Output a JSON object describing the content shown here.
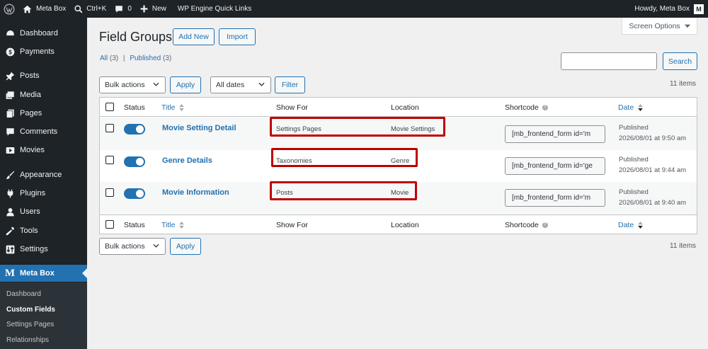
{
  "admin_bar": {
    "site_name": "Meta Box",
    "shortcut": "Ctrl+K",
    "comments_count": "0",
    "new_label": "New",
    "quick_links": "WP Engine Quick Links",
    "greeting": "Howdy, Meta Box",
    "avatar_letter": "M"
  },
  "sidebar": {
    "items": [
      {
        "label": "Dashboard",
        "icon": "dashboard-icon"
      },
      {
        "label": "Payments",
        "icon": "dollar-icon"
      },
      {
        "label": "Posts",
        "icon": "pin-icon"
      },
      {
        "label": "Media",
        "icon": "media-icon"
      },
      {
        "label": "Pages",
        "icon": "pages-icon"
      },
      {
        "label": "Comments",
        "icon": "comment-icon"
      },
      {
        "label": "Movies",
        "icon": "video-icon"
      },
      {
        "label": "Appearance",
        "icon": "paintbrush-icon"
      },
      {
        "label": "Plugins",
        "icon": "plugin-icon"
      },
      {
        "label": "Users",
        "icon": "user-icon"
      },
      {
        "label": "Tools",
        "icon": "wrench-icon"
      },
      {
        "label": "Settings",
        "icon": "settings-icon"
      }
    ],
    "current": {
      "label": "Meta Box",
      "icon_letter": "M"
    },
    "submenu": [
      "Dashboard",
      "Custom Fields",
      "Settings Pages",
      "Relationships"
    ]
  },
  "page": {
    "title": "Field Groups",
    "add_new": "Add New",
    "import": "Import",
    "screen_options": "Screen Options",
    "filters": {
      "all": "All",
      "all_count": "(3)",
      "separator": "|",
      "published": "Published",
      "published_count": "(3)"
    },
    "search_button": "Search",
    "bulk_actions": "Bulk actions",
    "apply": "Apply",
    "all_dates": "All dates",
    "filter": "Filter",
    "items_count": "11 items"
  },
  "table": {
    "columns": {
      "status": "Status",
      "title": "Title",
      "show_for": "Show For",
      "location": "Location",
      "shortcode": "Shortcode",
      "date": "Date"
    },
    "rows": [
      {
        "title": "Movie Setting Detail",
        "show_for": "Settings Pages",
        "location": "Movie Settings",
        "shortcode": "[mb_frontend_form id='m",
        "status": "Published",
        "date": "2026/08/01 at 9:50 am"
      },
      {
        "title": "Genre Details",
        "show_for": "Taxonomies",
        "location": "Genre",
        "shortcode": "[mb_frontend_form id='ge",
        "status": "Published",
        "date": "2026/08/01 at 9:44 am"
      },
      {
        "title": "Movie Information",
        "show_for": "Posts",
        "location": "Movie",
        "shortcode": "[mb_frontend_form id='m",
        "status": "Published",
        "date": "2026/08/01 at 9:40 am"
      }
    ]
  },
  "colors": {
    "accent": "#2271b1",
    "highlight": "#c00000",
    "sidebar": "#1d2327"
  }
}
